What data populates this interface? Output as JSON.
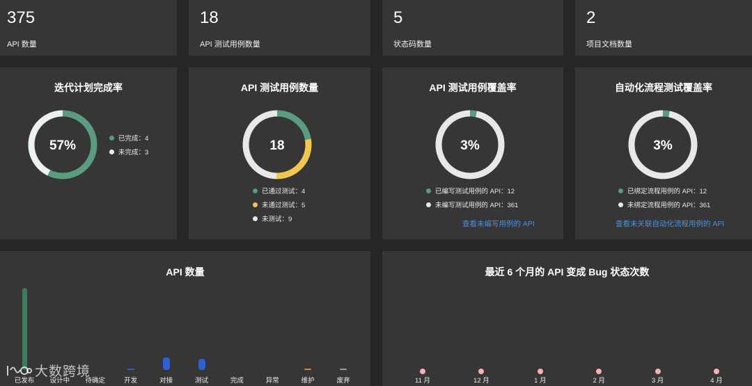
{
  "stats": [
    {
      "value": "375",
      "label": "API 数量"
    },
    {
      "value": "18",
      "label": "API 测试用例数量"
    },
    {
      "value": "5",
      "label": "状态码数量"
    },
    {
      "value": "2",
      "label": "项目文档数量"
    }
  ],
  "donuts": [
    {
      "title": "迭代计划完成率",
      "center": "57%",
      "legend": [
        {
          "label": "已完成：4",
          "value": 4,
          "color": "#5a9c80"
        },
        {
          "label": "未完成：3",
          "value": 3,
          "color": "#ecf2ef"
        }
      ]
    },
    {
      "title": "API 测试用例数量",
      "center": "18",
      "legend": [
        {
          "label": "已通过测试：4",
          "value": 4,
          "color": "#5a9c80"
        },
        {
          "label": "未通过测试：5",
          "value": 5,
          "color": "#f0c850"
        },
        {
          "label": "未测试：9",
          "value": 9,
          "color": "#e8e8e8"
        }
      ]
    },
    {
      "title": "API 测试用例覆盖率",
      "center": "3%",
      "legend": [
        {
          "label": "已编写测试用例的 API：12",
          "value": 12,
          "color": "#5a9c80"
        },
        {
          "label": "未编写测试用例的 API：361",
          "value": 361,
          "color": "#e8e8e8"
        }
      ],
      "link": "查看未编写用例的 API"
    },
    {
      "title": "自动化流程测试覆盖率",
      "center": "3%",
      "legend": [
        {
          "label": "已绑定流程用例的 API：12",
          "value": 12,
          "color": "#5a9c80"
        },
        {
          "label": "未绑定流程用例的 API：361",
          "value": 361,
          "color": "#e8e8e8"
        }
      ],
      "link": "查看未关联自动化流程用例的 API"
    }
  ],
  "api_chart": {
    "title": "API 数量",
    "categories": [
      "已发布",
      "设计中",
      "待确定",
      "开发",
      "对接",
      "测试",
      "完成",
      "异常",
      "维护",
      "废弃"
    ],
    "values": [
      360,
      0,
      0,
      1,
      5,
      4,
      0,
      0,
      1,
      1
    ],
    "colors": [
      "#3e7a5e",
      "#2e5fd6",
      "#2e5fd6",
      "#2e5fd6",
      "#2e5fd6",
      "#2e5fd6",
      "#2e5fd6",
      "#2e5fd6",
      "#e0822c",
      "#9a9a9a"
    ]
  },
  "bug_chart": {
    "title": "最近 6 个月的 API 变成 Bug 状态次数",
    "categories": [
      "11 月",
      "12 月",
      "1 月",
      "2 月",
      "3 月",
      "4 月"
    ],
    "values": [
      0,
      0,
      0,
      0,
      0,
      0
    ],
    "color": "#f4b1b4"
  },
  "watermark": "大数跨境"
}
